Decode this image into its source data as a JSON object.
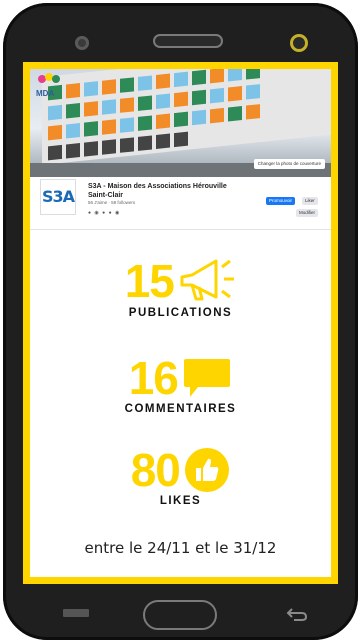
{
  "colors": {
    "accent_yellow": "#ffd500",
    "phone_body": "#1f1f1f",
    "text_dark": "#111111",
    "facebook_blue": "#1877f2"
  },
  "cover": {
    "logo_text": "MDA",
    "change_cover_button": "Changer la photo de couverture"
  },
  "profile": {
    "avatar_text": "S3A",
    "page_name": "S3A - Maison des Associations Hérouville Saint-Clair",
    "subtitle": "56 J'aime · 58 followers",
    "btn_primary": "Promouvoir",
    "btn_secondary": "Liker",
    "btn_edit": "Modifier"
  },
  "stats": [
    {
      "value": "15",
      "label": "PUBLICATIONS",
      "icon": "megaphone-icon"
    },
    {
      "value": "16",
      "label": "COMMENTAIRES",
      "icon": "comment-bubble-icon"
    },
    {
      "value": "80",
      "label": "LIKES",
      "icon": "thumbs-up-icon"
    }
  ],
  "footer": {
    "period_text": "entre le 24/11 et le 31/12"
  }
}
